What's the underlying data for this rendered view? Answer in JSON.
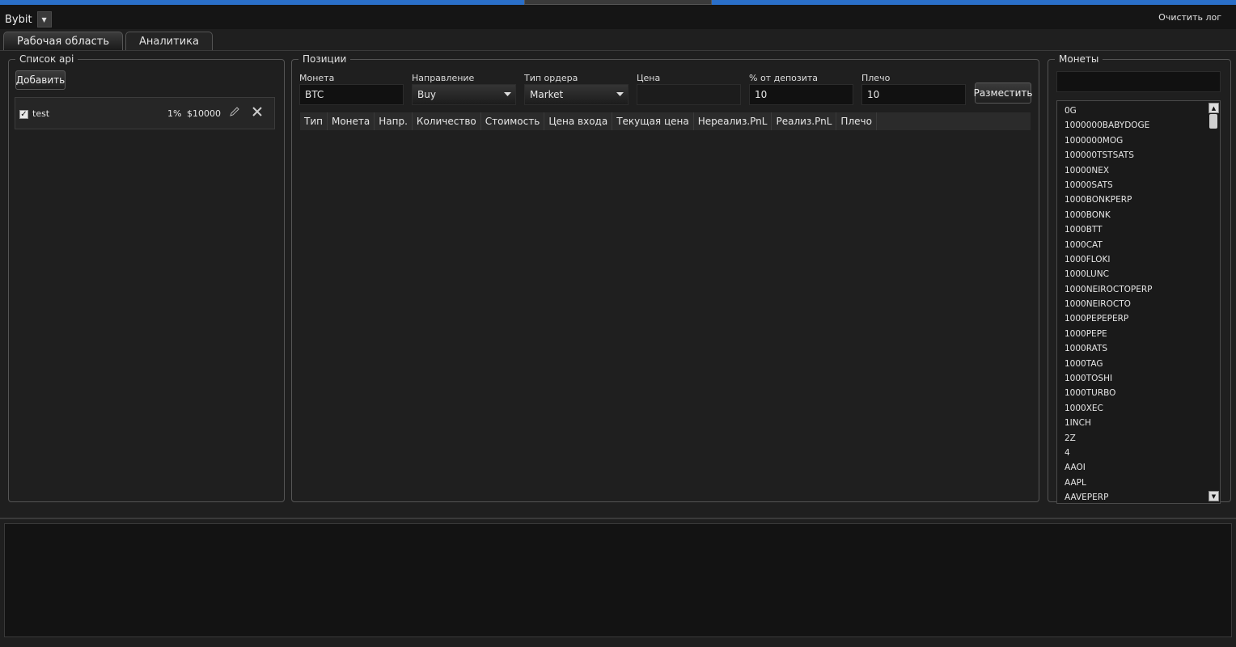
{
  "header": {
    "exchange": "Bybit",
    "clear_log_label": "Очистить лог"
  },
  "tabs": [
    {
      "label": "Рабочая область",
      "active": true
    },
    {
      "label": "Аналитика",
      "active": false
    }
  ],
  "api_panel": {
    "title": "Список api",
    "add_label": "Добавить",
    "items": [
      {
        "checked": true,
        "name": "test",
        "percent": "1%",
        "deposit": "$10000"
      }
    ]
  },
  "positions": {
    "title": "Позиции",
    "coin_label": "Монета",
    "coin_value": "BTC",
    "direction_label": "Направление",
    "direction_value": "Buy",
    "order_type_label": "Тип ордера",
    "order_type_value": "Market",
    "price_label": "Цена",
    "price_value": "",
    "deposit_pct_label": "% от депозита",
    "deposit_pct_value": "10",
    "leverage_label": "Плечо",
    "leverage_value": "10",
    "place_label": "Разместить",
    "columns": [
      "Тип",
      "Монета",
      "Напр.",
      "Количество",
      "Стоимость",
      "Цена входа",
      "Текущая цена",
      "Нереализ.PnL",
      "Реализ.PnL",
      "Плечо"
    ]
  },
  "coins": {
    "title": "Монеты",
    "search_value": "",
    "items": [
      "0G",
      "1000000BABYDOGE",
      "1000000MOG",
      "100000TSTSATS",
      "10000NEX",
      "10000SATS",
      "1000BONKPERP",
      "1000BONK",
      "1000BTT",
      "1000CAT",
      "1000FLOKI",
      "1000LUNC",
      "1000NEIROCTOPERP",
      "1000NEIROCTO",
      "1000PEPEPERP",
      "1000PEPE",
      "1000RATS",
      "1000TAG",
      "1000TOSHI",
      "1000TURBO",
      "1000XEC",
      "1INCH",
      "2Z",
      "4",
      "AAOI",
      "AAPL",
      "AAVEPERP"
    ]
  },
  "colors": {
    "background": "#1f1f1f",
    "input_bg": "#111111",
    "title_accent": "#2a6fc9"
  }
}
